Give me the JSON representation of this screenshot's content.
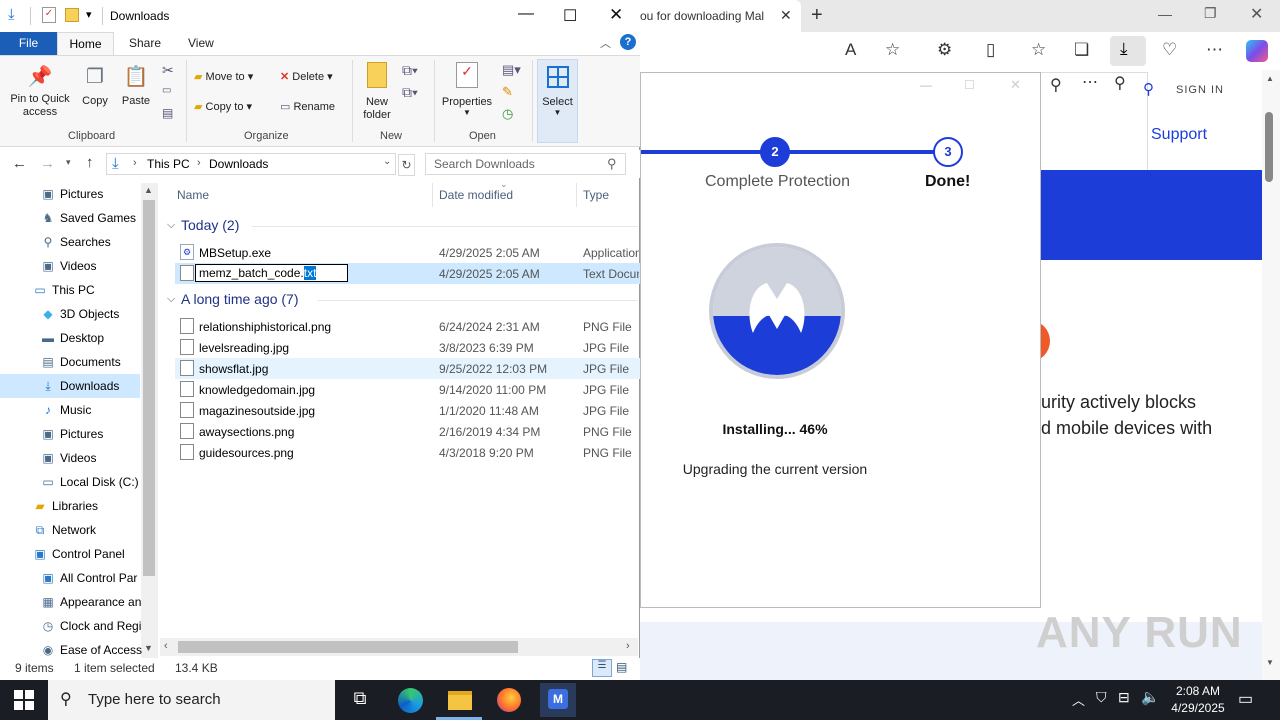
{
  "explorer": {
    "title": "Downloads",
    "ribbon_tabs": {
      "file": "File",
      "home": "Home",
      "share": "Share",
      "view": "View"
    },
    "ribbon": {
      "pin_label": "Pin to Quick access",
      "copy_label": "Copy",
      "paste_label": "Paste",
      "clipboard_group": "Clipboard",
      "move_to_label": "Move to",
      "copy_to_label": "Copy to",
      "delete_label": "Delete",
      "rename_label": "Rename",
      "organize_group": "Organize",
      "new_folder_label": "New folder",
      "new_group": "New",
      "properties_label": "Properties",
      "open_group": "Open",
      "select_label": "Select"
    },
    "address": {
      "this_pc": "This PC",
      "downloads": "Downloads"
    },
    "search_placeholder": "Search Downloads",
    "nav": [
      {
        "label": "Pictures",
        "icon": "pictures-icon"
      },
      {
        "label": "Saved Games",
        "icon": "saved-games-icon"
      },
      {
        "label": "Searches",
        "icon": "searches-icon"
      },
      {
        "label": "Videos",
        "icon": "videos-icon"
      },
      {
        "label": "This PC",
        "icon": "this-pc-icon"
      },
      {
        "label": "3D Objects",
        "icon": "3d-objects-icon"
      },
      {
        "label": "Desktop",
        "icon": "desktop-icon"
      },
      {
        "label": "Documents",
        "icon": "documents-icon"
      },
      {
        "label": "Downloads",
        "icon": "downloads-icon"
      },
      {
        "label": "Music",
        "icon": "music-icon"
      },
      {
        "label": "Pictures",
        "icon": "pictures-icon"
      },
      {
        "label": "Videos",
        "icon": "videos-icon"
      },
      {
        "label": "Local Disk (C:)",
        "icon": "disk-icon"
      },
      {
        "label": "Libraries",
        "icon": "libraries-icon"
      },
      {
        "label": "Network",
        "icon": "network-icon"
      },
      {
        "label": "Control Panel",
        "icon": "control-panel-icon"
      },
      {
        "label": "All Control Par",
        "icon": "control-panel-icon"
      },
      {
        "label": "Appearance an",
        "icon": "appearance-icon"
      },
      {
        "label": "Clock and Regi",
        "icon": "clock-icon"
      },
      {
        "label": "Ease of Access",
        "icon": "ease-of-access-icon"
      }
    ],
    "columns": {
      "name": "Name",
      "date": "Date modified",
      "type": "Type"
    },
    "groups": {
      "today": "Today (2)",
      "older": "A long time ago (7)"
    },
    "files_today": [
      {
        "name": "MBSetup.exe",
        "date": "4/29/2025 2:05 AM",
        "type": "Application"
      },
      {
        "name": "memz_batch_code.txt",
        "date": "4/29/2025 2:05 AM",
        "type": "Text Docum"
      }
    ],
    "rename_value": {
      "base": "memz_batch_code.",
      "ext": "txt"
    },
    "files_older": [
      {
        "name": "relationshiphistorical.png",
        "date": "6/24/2024 2:31 AM",
        "type": "PNG File"
      },
      {
        "name": "levelsreading.jpg",
        "date": "3/8/2023 6:39 PM",
        "type": "JPG File"
      },
      {
        "name": "showsflat.jpg",
        "date": "9/25/2022 12:03 PM",
        "type": "JPG File"
      },
      {
        "name": "knowledgedomain.jpg",
        "date": "9/14/2020 11:00 PM",
        "type": "JPG File"
      },
      {
        "name": "magazinesoutside.jpg",
        "date": "1/1/2020 11:48 AM",
        "type": "JPG File"
      },
      {
        "name": "awaysections.png",
        "date": "2/16/2019 4:34 PM",
        "type": "PNG File"
      },
      {
        "name": "guidesources.png",
        "date": "4/3/2018 9:20 PM",
        "type": "PNG File"
      }
    ],
    "status": {
      "items": "9 items",
      "selected": "1 item selected",
      "size": "13.4 KB"
    }
  },
  "browser": {
    "tab_title": "ou for downloading Mal",
    "site": {
      "support": "Support",
      "sign_in": "SIGN IN",
      "text1": "urity actively blocks",
      "text2": "d mobile devices with"
    },
    "watermark": "ANY RUN"
  },
  "installer": {
    "step2_num": "2",
    "step2_label": "Complete Protection",
    "step3_num": "3",
    "step3_label": "Done!",
    "status": "Installing... 46%",
    "progress_percent": 46,
    "substatus": "Upgrading the current version"
  },
  "taskbar": {
    "search_placeholder": "Type here to search",
    "time": "2:08 AM",
    "date": "4/29/2025"
  }
}
